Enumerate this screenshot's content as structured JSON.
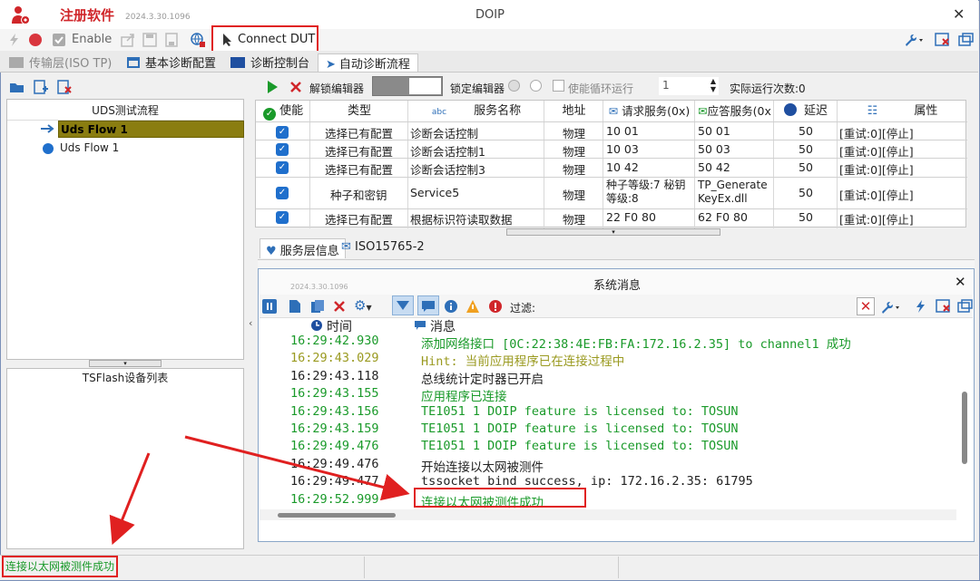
{
  "app": {
    "name": "注册软件",
    "version": "2024.3.30.1096",
    "window_title": "DOIP"
  },
  "toolbar": {
    "enable_label": "Enable",
    "connect_label": "Connect DUT"
  },
  "tabs": [
    {
      "label": "传输层(ISO TP)"
    },
    {
      "label": "基本诊断配置"
    },
    {
      "label": "诊断控制台"
    },
    {
      "label": "自动诊断流程"
    }
  ],
  "editor_bar": {
    "unlock_label": "解锁编辑器",
    "lock_label": "锁定编辑器",
    "loop_label": "使能循环运行",
    "loop_count": "1",
    "run_count_label": "实际运行次数:0"
  },
  "left": {
    "flow_header": "UDS测试流程",
    "flows": [
      {
        "label": "Uds Flow 1"
      },
      {
        "label": "Uds Flow 1"
      }
    ],
    "device_header": "TSFlash设备列表"
  },
  "grid": {
    "headers": [
      "使能",
      "类型",
      "服务名称",
      "地址",
      "请求服务(0x)",
      "应答服务(0x",
      "延迟",
      "属性"
    ],
    "rows": [
      {
        "type": "选择已有配置",
        "name": "诊断会话控制",
        "addr": "物理",
        "req": "10 01",
        "resp": "50 01",
        "delay": "50",
        "attr": "[重试:0][停止]"
      },
      {
        "type": "选择已有配置",
        "name": "诊断会话控制1",
        "addr": "物理",
        "req": "10 03",
        "resp": "50 03",
        "delay": "50",
        "attr": "[重试:0][停止]"
      },
      {
        "type": "选择已有配置",
        "name": "诊断会话控制3",
        "addr": "物理",
        "req": "10 42",
        "resp": "50 42",
        "delay": "50",
        "attr": "[重试:0][停止]"
      },
      {
        "type": "种子和密钥",
        "name": "Service5",
        "addr": "物理",
        "req": "种子等级:7 秘钥等级:8",
        "resp": "TP_GenerateKeyEx.dll",
        "delay": "50",
        "attr": "[重试:0][停止]"
      },
      {
        "type": "选择已有配置",
        "name": "根据标识符读取数据",
        "addr": "物理",
        "req": "22 F0 80",
        "resp": "62 F0 80",
        "delay": "50",
        "attr": "[重试:0][停止]"
      }
    ]
  },
  "lower_tabs": [
    {
      "label": "服务层信息"
    },
    {
      "label": "ISO15765-2"
    }
  ],
  "sysmsg": {
    "title": "系统消息",
    "version": "2024.3.30.1096",
    "filter_label": "过滤:",
    "col_time": "时间",
    "col_msg": "消息",
    "logs": [
      {
        "time": "16:29:42.930",
        "msg": "添加网络接口 [0C:22:38:4E:FB:FA:172.16.2.35] to channel1 成功",
        "color": "green"
      },
      {
        "time": "16:29:43.029",
        "msg": "Hint: 当前应用程序已在连接过程中",
        "color": "olive"
      },
      {
        "time": "16:29:43.118",
        "msg": "总线统计定时器已开启",
        "color": "dark"
      },
      {
        "time": "16:29:43.155",
        "msg": "应用程序已连接",
        "color": "green"
      },
      {
        "time": "16:29:43.156",
        "msg": "TE1051 1 DOIP feature is licensed to: TOSUN",
        "color": "green"
      },
      {
        "time": "16:29:43.159",
        "msg": "TE1051 1 DOIP feature is licensed to: TOSUN",
        "color": "green"
      },
      {
        "time": "16:29:49.476",
        "msg": "TE1051 1 DOIP feature is licensed to: TOSUN",
        "color": "green"
      },
      {
        "time": "16:29:49.476",
        "msg": "开始连接以太网被测件",
        "color": "dark"
      },
      {
        "time": "16:29:49.477",
        "msg": "tssocket bind success, ip: 172.16.2.35: 61795",
        "color": "dark"
      },
      {
        "time": "16:29:52.999",
        "msg": "连接以太网被测件成功",
        "color": "green"
      }
    ]
  },
  "status": {
    "message": "连接以太网被测件成功"
  },
  "colors": {
    "highlight_red": "#e02020",
    "log_green": "#1a9a2a",
    "flow_selected": "#8a7d10"
  }
}
